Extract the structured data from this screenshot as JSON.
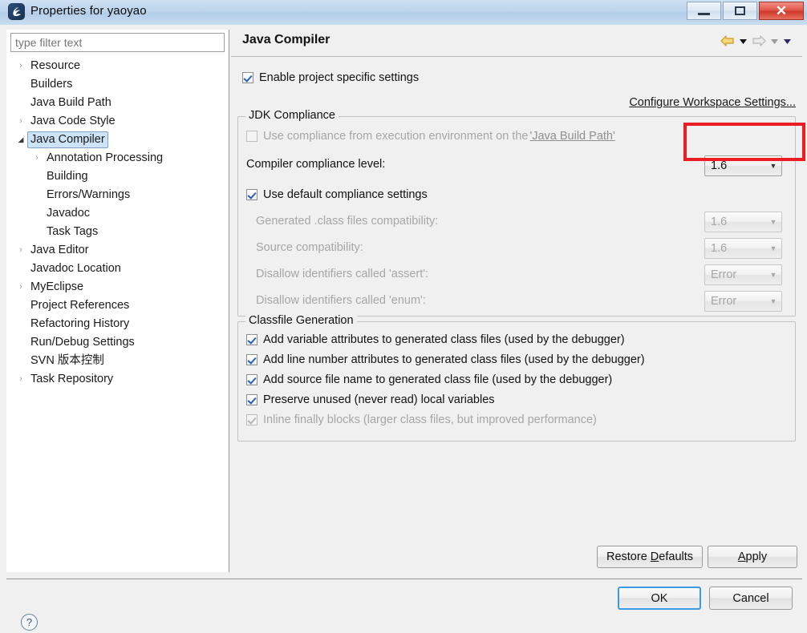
{
  "window": {
    "title": "Properties for yaoyao",
    "icon": "eclipse-properties-icon",
    "buttons": {
      "minimize": "–",
      "restore": "❐",
      "close": "✕"
    }
  },
  "sidebar": {
    "filter": {
      "placeholder": "type filter text",
      "value": ""
    },
    "items": [
      {
        "label": "Resource",
        "indent": 0,
        "twisty": "collapsed",
        "selected": false
      },
      {
        "label": "Builders",
        "indent": 0,
        "twisty": "none",
        "selected": false
      },
      {
        "label": "Java Build Path",
        "indent": 0,
        "twisty": "none",
        "selected": false
      },
      {
        "label": "Java Code Style",
        "indent": 0,
        "twisty": "collapsed",
        "selected": false
      },
      {
        "label": "Java Compiler",
        "indent": 0,
        "twisty": "expanded",
        "selected": true
      },
      {
        "label": "Annotation Processing",
        "indent": 1,
        "twisty": "collapsed",
        "selected": false
      },
      {
        "label": "Building",
        "indent": 1,
        "twisty": "none",
        "selected": false
      },
      {
        "label": "Errors/Warnings",
        "indent": 1,
        "twisty": "none",
        "selected": false
      },
      {
        "label": "Javadoc",
        "indent": 1,
        "twisty": "none",
        "selected": false
      },
      {
        "label": "Task Tags",
        "indent": 1,
        "twisty": "none",
        "selected": false
      },
      {
        "label": "Java Editor",
        "indent": 0,
        "twisty": "collapsed",
        "selected": false
      },
      {
        "label": "Javadoc Location",
        "indent": 0,
        "twisty": "none",
        "selected": false
      },
      {
        "label": "MyEclipse",
        "indent": 0,
        "twisty": "collapsed",
        "selected": false
      },
      {
        "label": "Project References",
        "indent": 0,
        "twisty": "none",
        "selected": false
      },
      {
        "label": "Refactoring History",
        "indent": 0,
        "twisty": "none",
        "selected": false
      },
      {
        "label": "Run/Debug Settings",
        "indent": 0,
        "twisty": "none",
        "selected": false
      },
      {
        "label": "SVN 版本控制",
        "indent": 0,
        "twisty": "none",
        "selected": false
      },
      {
        "label": "Task Repository",
        "indent": 0,
        "twisty": "collapsed",
        "selected": false
      }
    ]
  },
  "page": {
    "title": "Java Compiler",
    "nav": {
      "back_icon": "back-arrow-icon",
      "back_menu_icon": "chevron-down-icon",
      "forward_icon": "forward-arrow-icon",
      "forward_menu_icon": "chevron-down-icon",
      "view_menu_icon": "chevron-down-icon"
    },
    "enable_specific": {
      "label": "Enable project specific settings",
      "checked": true,
      "enabled": true
    },
    "configure_link": "Configure Workspace Settings..."
  },
  "jdk_compliance": {
    "title": "JDK Compliance",
    "use_execution_env": {
      "label_prefix": "Use compliance from execution environment on the ",
      "label_link": "'Java Build Path'",
      "checked": false,
      "enabled": false
    },
    "compiler_level": {
      "label": "Compiler compliance level:",
      "value": "1.6",
      "enabled": true,
      "highlighted": true
    },
    "use_default": {
      "label": "Use default compliance settings",
      "checked": true,
      "enabled": true
    },
    "fields": [
      {
        "label": "Generated .class files compatibility:",
        "value": "1.6",
        "enabled": false
      },
      {
        "label": "Source compatibility:",
        "value": "1.6",
        "enabled": false
      },
      {
        "label": "Disallow identifiers called 'assert':",
        "value": "Error",
        "enabled": false
      },
      {
        "label": "Disallow identifiers called 'enum':",
        "value": "Error",
        "enabled": false
      }
    ]
  },
  "classfile_generation": {
    "title": "Classfile Generation",
    "options": [
      {
        "label": "Add variable attributes to generated class files (used by the debugger)",
        "checked": true,
        "enabled": true
      },
      {
        "label": "Add line number attributes to generated class files (used by the debugger)",
        "checked": true,
        "enabled": true
      },
      {
        "label": "Add source file name to generated class file (used by the debugger)",
        "checked": true,
        "enabled": true
      },
      {
        "label": "Preserve unused (never read) local variables",
        "checked": true,
        "enabled": true
      },
      {
        "label": "Inline finally blocks (larger class files, but improved performance)",
        "checked": true,
        "enabled": false
      }
    ]
  },
  "page_buttons": {
    "restore_defaults": "Restore Defaults",
    "apply": "Apply"
  },
  "footer": {
    "help_icon": "help-icon",
    "help_glyph": "?",
    "ok": "OK",
    "cancel": "Cancel"
  },
  "colors": {
    "accent_selection": "#cde3f7",
    "highlight_box": "#ed1c24",
    "default_button_border": "#3c9ade",
    "titlebar": "#bcd4ec",
    "close_button": "#cf3a2b"
  }
}
